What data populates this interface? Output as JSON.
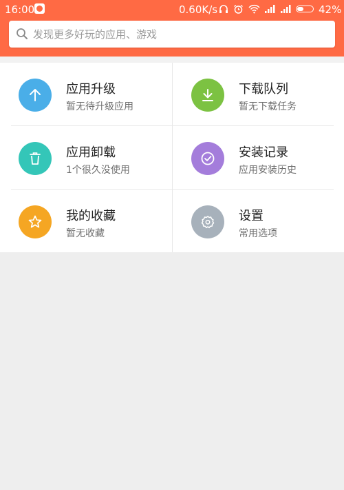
{
  "status_bar": {
    "time": "16:00",
    "network_speed": "0.60K/s",
    "battery_percent": "42%",
    "battery_level": 0.42,
    "icons": [
      "app-notification-icon",
      "headphones-icon",
      "alarm-icon",
      "wifi-icon",
      "signal-icon",
      "signal-icon",
      "battery-icon"
    ]
  },
  "search": {
    "placeholder": "发现更多好玩的应用、游戏",
    "value": ""
  },
  "grid": {
    "items": [
      {
        "title": "应用升级",
        "subtitle": "暂无待升级应用",
        "icon": "arrow-up-icon",
        "color": "#4aaee8"
      },
      {
        "title": "下载队列",
        "subtitle": "暂无下载任务",
        "icon": "download-icon",
        "color": "#7cc242"
      },
      {
        "title": "应用卸载",
        "subtitle": "1个很久没使用",
        "icon": "trash-icon",
        "color": "#34c6b8"
      },
      {
        "title": "安装记录",
        "subtitle": "应用安装历史",
        "icon": "check-circle-icon",
        "color": "#a47ddb"
      },
      {
        "title": "我的收藏",
        "subtitle": "暂无收藏",
        "icon": "star-icon",
        "color": "#f5a623"
      },
      {
        "title": "设置",
        "subtitle": "常用选项",
        "icon": "gear-icon",
        "color": "#a7b1bb"
      }
    ]
  },
  "colors": {
    "header": "#ff6a44",
    "background": "#eeeeee"
  }
}
